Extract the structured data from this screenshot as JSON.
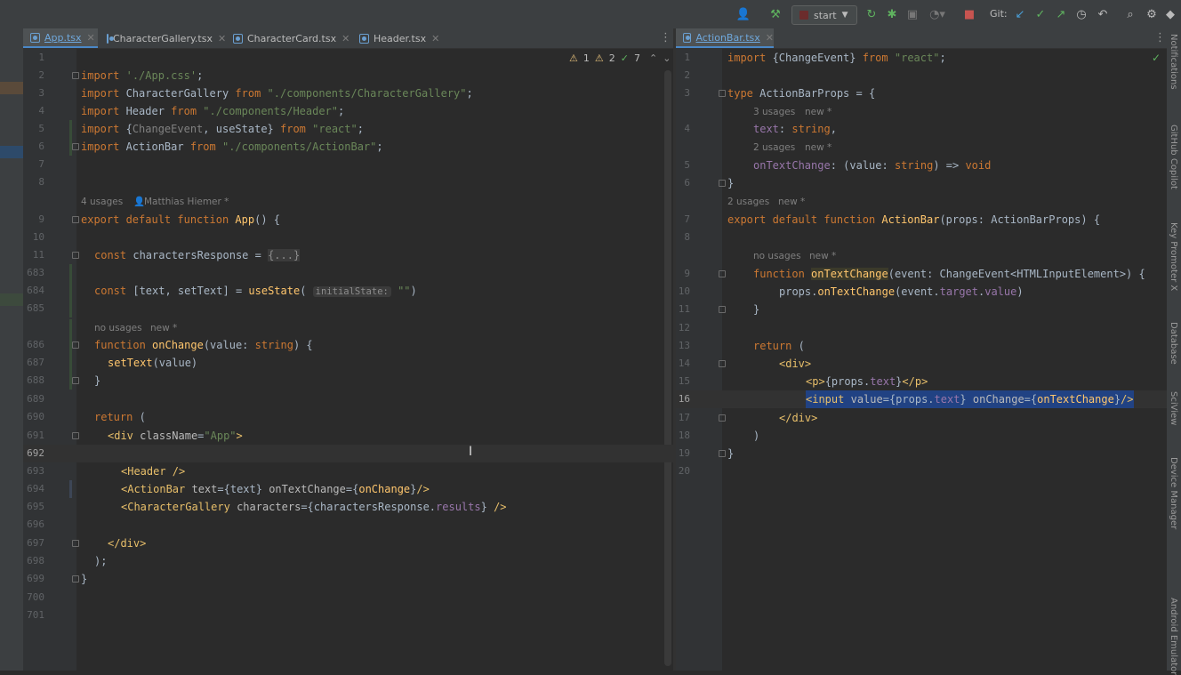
{
  "toolbar": {
    "run_config": "start",
    "git_label": "Git:",
    "icons": [
      "user-icon",
      "hammer-icon",
      "rerun-icon",
      "debug-icon",
      "coverage-icon",
      "profiler-icon",
      "stop-icon",
      "vcs-update-icon",
      "vcs-commit-icon",
      "vcs-push-icon",
      "history-icon",
      "rollback-icon",
      "search-icon",
      "settings-icon",
      "ide-logo-icon"
    ]
  },
  "left_editor": {
    "tabs": [
      {
        "label": "App.tsx",
        "active": true
      },
      {
        "label": "CharacterGallery.tsx",
        "active": false
      },
      {
        "label": "CharacterCard.tsx",
        "active": false
      },
      {
        "label": "Header.tsx",
        "active": false
      }
    ],
    "inspections": {
      "warnings": "1",
      "weak_warnings": "2",
      "typos": "7"
    },
    "hints": {
      "usages_author": "4 usages",
      "author": "Matthias Hiemer *",
      "no_usages": "no usages",
      "new": "new *",
      "initial_state": "initialState:"
    },
    "line_numbers": [
      "1",
      "2",
      "3",
      "4",
      "5",
      "6",
      "7",
      "8",
      "9",
      "10",
      "11",
      "683",
      "684",
      "685",
      "686",
      "687",
      "688",
      "689",
      "690",
      "691",
      "692",
      "693",
      "694",
      "695",
      "696",
      "697",
      "698",
      "699",
      "700",
      "701"
    ],
    "current_line": "692"
  },
  "right_editor": {
    "tabs": [
      {
        "label": "ActionBar.tsx",
        "active": true
      }
    ],
    "hints": {
      "usages3": "3 usages",
      "usages2": "2 usages",
      "usages2b": "2 usages",
      "no_usages": "no usages",
      "new": "new *"
    },
    "line_numbers": [
      "1",
      "2",
      "3",
      "4",
      "5",
      "6",
      "7",
      "8",
      "9",
      "10",
      "11",
      "12",
      "13",
      "14",
      "15",
      "16",
      "17",
      "18",
      "19",
      "20"
    ],
    "current_line": "16"
  },
  "right_strip_labels": [
    "Notifications",
    "GitHub Copilot",
    "Key Promoter X",
    "Database",
    "SciView",
    "Device Manager",
    "Android Emulator"
  ]
}
